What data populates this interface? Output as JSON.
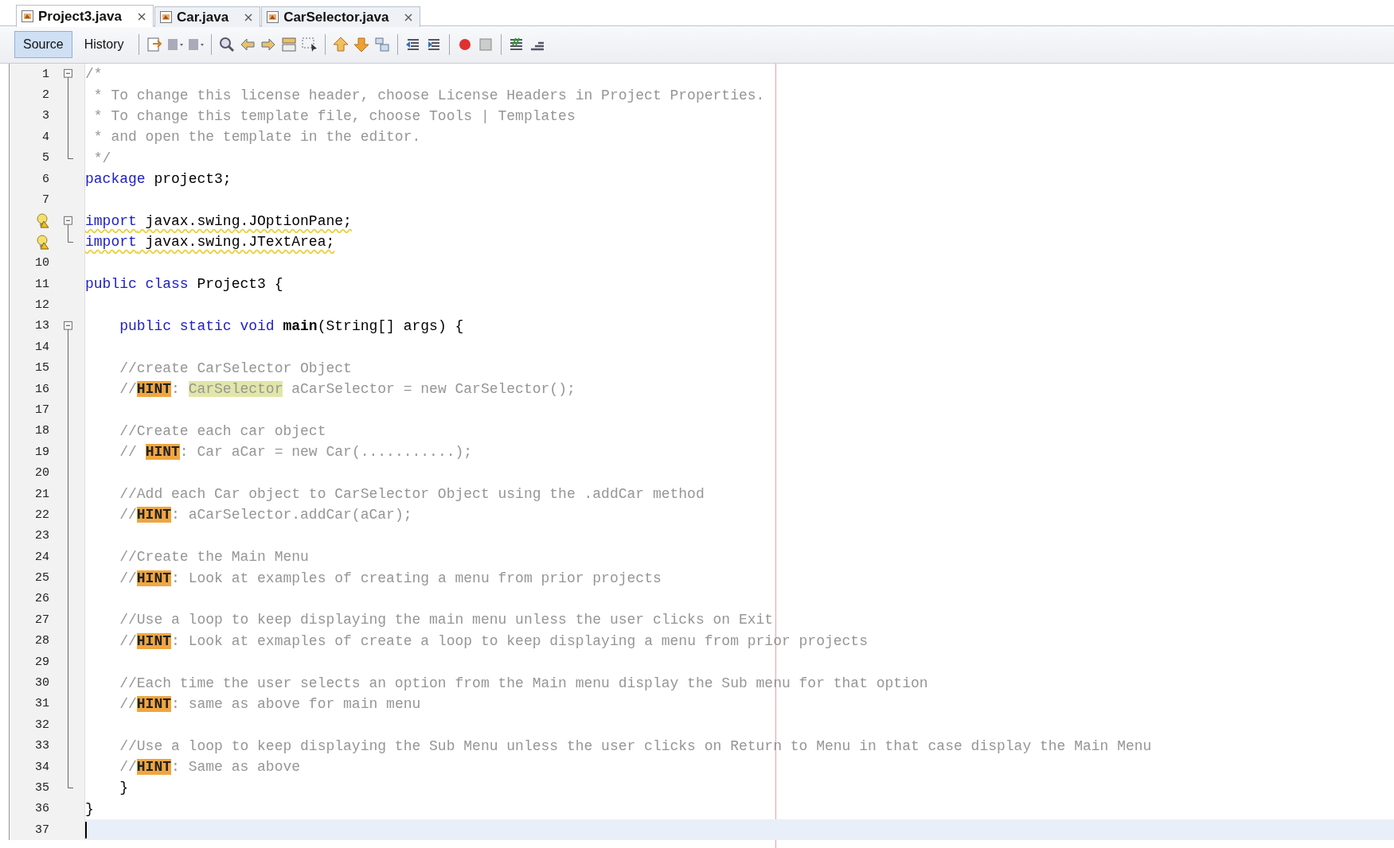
{
  "file_tabs": [
    {
      "label": "Project3.java",
      "selected": true
    },
    {
      "label": "Car.java",
      "selected": false
    },
    {
      "label": "CarSelector.java",
      "selected": false
    }
  ],
  "view_tabs": [
    {
      "label": "Source",
      "selected": true
    },
    {
      "label": "History",
      "selected": false
    }
  ],
  "editor": {
    "lines": [
      {
        "number": "1",
        "kind": "fold_start",
        "segments": [
          {
            "kind": "comment",
            "text": "/*"
          }
        ]
      },
      {
        "number": "2",
        "kind": "fold_body",
        "segments": [
          {
            "kind": "comment",
            "text": " * To change this license header, choose License Headers in Project Properties."
          }
        ]
      },
      {
        "number": "3",
        "kind": "fold_body",
        "segments": [
          {
            "kind": "comment",
            "text": " * To change this template file, choose Tools | Templates"
          }
        ]
      },
      {
        "number": "4",
        "kind": "fold_body",
        "segments": [
          {
            "kind": "comment",
            "text": " * and open the template in the editor."
          }
        ]
      },
      {
        "number": "5",
        "kind": "fold_end",
        "segments": [
          {
            "kind": "comment",
            "text": " */"
          }
        ]
      },
      {
        "number": "6",
        "kind": "plain",
        "segments": [
          {
            "kind": "keyword",
            "text": "package"
          },
          {
            "kind": "plain",
            "text": " project3;"
          }
        ]
      },
      {
        "number": "7",
        "kind": "plain"
      },
      {
        "warning": true,
        "kind": "fold_start",
        "segments": [
          {
            "kind": "keyword",
            "text": "import"
          },
          {
            "kind": "plain",
            "text": " javax.swing.JOptionPane;"
          }
        ]
      },
      {
        "warning": true,
        "kind": "fold_end",
        "segments": [
          {
            "kind": "keyword",
            "text": "import"
          },
          {
            "kind": "plain",
            "text": " javax.swing.JTextArea;"
          }
        ]
      },
      {
        "number": "10",
        "kind": "plain"
      },
      {
        "number": "11",
        "kind": "plain",
        "segments": [
          {
            "kind": "keyword",
            "text": "public class"
          },
          {
            "kind": "plain",
            "text": " Project3 {"
          }
        ]
      },
      {
        "number": "12",
        "kind": "plain"
      },
      {
        "number": "13",
        "kind": "fold_start",
        "segments": [
          {
            "kind": "keyword",
            "text": "    public static void "
          },
          {
            "kind": "method",
            "text": "main"
          },
          {
            "kind": "plain",
            "text": "(String[] args) {"
          }
        ]
      },
      {
        "number": "14",
        "kind": "fold_body"
      },
      {
        "number": "15",
        "kind": "fold_body",
        "segments": [
          {
            "kind": "comment",
            "text": "    //create CarSelector Object"
          }
        ]
      },
      {
        "number": "16",
        "kind": "fold_body",
        "segments": [
          {
            "kind": "comment",
            "text": "    //"
          },
          {
            "kind": "hint",
            "text": "HINT"
          },
          {
            "kind": "comment",
            "text": ": "
          },
          {
            "kind": "highlight",
            "text": "CarSelector"
          },
          {
            "kind": "comment",
            "text": " aCarSelector = new CarSelector();"
          }
        ]
      },
      {
        "number": "17",
        "kind": "fold_body"
      },
      {
        "number": "18",
        "kind": "fold_body",
        "segments": [
          {
            "kind": "comment",
            "text": "    //Create each car object"
          }
        ]
      },
      {
        "number": "19",
        "kind": "fold_body",
        "segments": [
          {
            "kind": "comment",
            "text": "    // "
          },
          {
            "kind": "hint",
            "text": "HINT"
          },
          {
            "kind": "comment",
            "text": ": Car aCar = new Car(...........);"
          }
        ]
      },
      {
        "number": "20",
        "kind": "fold_body"
      },
      {
        "number": "21",
        "kind": "fold_body",
        "segments": [
          {
            "kind": "comment",
            "text": "    //Add each Car object to CarSelector Object using the .addCar method"
          }
        ]
      },
      {
        "number": "22",
        "kind": "fold_body",
        "segments": [
          {
            "kind": "comment",
            "text": "    //"
          },
          {
            "kind": "hint",
            "text": "HINT"
          },
          {
            "kind": "comment",
            "text": ": aCarSelector.addCar(aCar);"
          }
        ]
      },
      {
        "number": "23",
        "kind": "fold_body"
      },
      {
        "number": "24",
        "kind": "fold_body",
        "segments": [
          {
            "kind": "comment",
            "text": "    //Create the Main Menu"
          }
        ]
      },
      {
        "number": "25",
        "kind": "fold_body",
        "segments": [
          {
            "kind": "comment",
            "text": "    //"
          },
          {
            "kind": "hint",
            "text": "HINT"
          },
          {
            "kind": "comment",
            "text": ": Look at examples of creating a menu from prior projects"
          }
        ]
      },
      {
        "number": "26",
        "kind": "fold_body"
      },
      {
        "number": "27",
        "kind": "fold_body",
        "segments": [
          {
            "kind": "comment",
            "text": "    //Use a loop to keep displaying the main menu unless the user clicks on Exit"
          }
        ]
      },
      {
        "number": "28",
        "kind": "fold_body",
        "segments": [
          {
            "kind": "comment",
            "text": "    //"
          },
          {
            "kind": "hint",
            "text": "HINT"
          },
          {
            "kind": "comment",
            "text": ": Look at exmaples of create a loop to keep displaying a menu from prior projects"
          }
        ]
      },
      {
        "number": "29",
        "kind": "fold_body"
      },
      {
        "number": "30",
        "kind": "fold_body",
        "segments": [
          {
            "kind": "comment",
            "text": "    //Each time the user selects an option from the Main menu display the Sub menu for that option"
          }
        ]
      },
      {
        "number": "31",
        "kind": "fold_body",
        "segments": [
          {
            "kind": "comment",
            "text": "    //"
          },
          {
            "kind": "hint",
            "text": "HINT"
          },
          {
            "kind": "comment",
            "text": ": same as above for main menu"
          }
        ]
      },
      {
        "number": "32",
        "kind": "fold_body"
      },
      {
        "number": "33",
        "kind": "fold_body",
        "segments": [
          {
            "kind": "comment",
            "text": "    //Use a loop to keep displaying the Sub Menu unless the user clicks on Return to Menu in that case display the Main Menu"
          }
        ]
      },
      {
        "number": "34",
        "kind": "fold_body",
        "segments": [
          {
            "kind": "comment",
            "text": "    //"
          },
          {
            "kind": "hint",
            "text": "HINT"
          },
          {
            "kind": "comment",
            "text": ": Same as above"
          }
        ]
      },
      {
        "number": "35",
        "kind": "fold_end",
        "segments": [
          {
            "kind": "plain",
            "text": "    }"
          }
        ]
      },
      {
        "number": "36",
        "kind": "plain",
        "segments": [
          {
            "kind": "plain",
            "text": "}"
          }
        ]
      },
      {
        "number": "37",
        "kind": "plain",
        "current": true
      }
    ]
  }
}
